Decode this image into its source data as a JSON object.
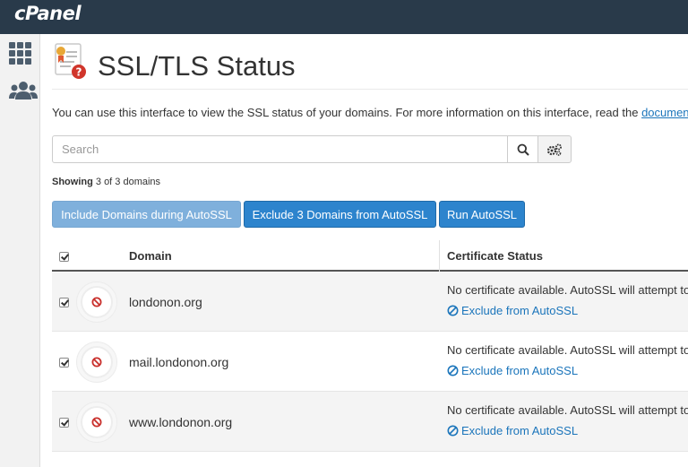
{
  "app": {
    "logo": "cPanel"
  },
  "page": {
    "title": "SSL/TLS Status",
    "intro_text": "You can use this interface to view the SSL status of your domains. For more information on this interface, read the ",
    "intro_link": "documentation"
  },
  "search": {
    "placeholder": "Search"
  },
  "showing": {
    "label": "Showing",
    "count_text": "3 of 3 domains"
  },
  "actions": {
    "include": "Include Domains during AutoSSL",
    "exclude": "Exclude 3 Domains from AutoSSL",
    "run": "Run AutoSSL"
  },
  "table": {
    "columns": {
      "domain": "Domain",
      "status": "Certificate Status"
    },
    "rows": [
      {
        "domain": "londonon.org",
        "status": "No certificate available. AutoSSL will attempt to",
        "link": "Exclude from AutoSSL"
      },
      {
        "domain": "mail.londonon.org",
        "status": "No certificate available. AutoSSL will attempt to",
        "link": "Exclude from AutoSSL"
      },
      {
        "domain": "www.londonon.org",
        "status": "No certificate available. AutoSSL will attempt to",
        "link": "Exclude from AutoSSL"
      }
    ]
  },
  "colors": {
    "topbar": "#293a4a",
    "primary": "#2d84cd",
    "link": "#1b75bb",
    "error": "#c9302c"
  }
}
